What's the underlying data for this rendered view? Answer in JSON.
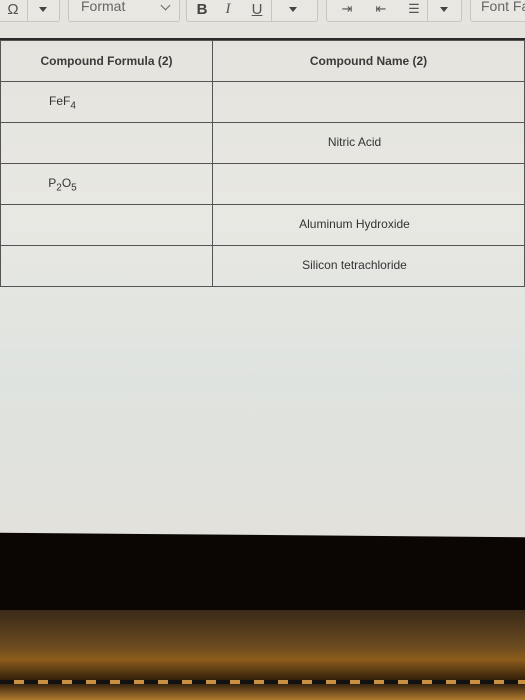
{
  "toolbar": {
    "omega_icon": "Ω",
    "format_label": "Format",
    "bold_label": "B",
    "italic_label": "I",
    "underline_label": "U",
    "font_family_label": "Font Fa"
  },
  "table": {
    "headers": [
      "Compound Formula (2)",
      "Compound Name (2)"
    ],
    "rows": [
      {
        "formula": "FeF",
        "formula_sub": "4",
        "name": ""
      },
      {
        "formula": "",
        "name": "Nitric Acid"
      },
      {
        "formula": "P",
        "formula_sub": "2",
        "formula2": "O",
        "formula2_sub": "5",
        "name": ""
      },
      {
        "formula": "",
        "name": "Aluminum Hydroxide"
      },
      {
        "formula": "",
        "name": "Silicon tetrachloride"
      }
    ]
  }
}
